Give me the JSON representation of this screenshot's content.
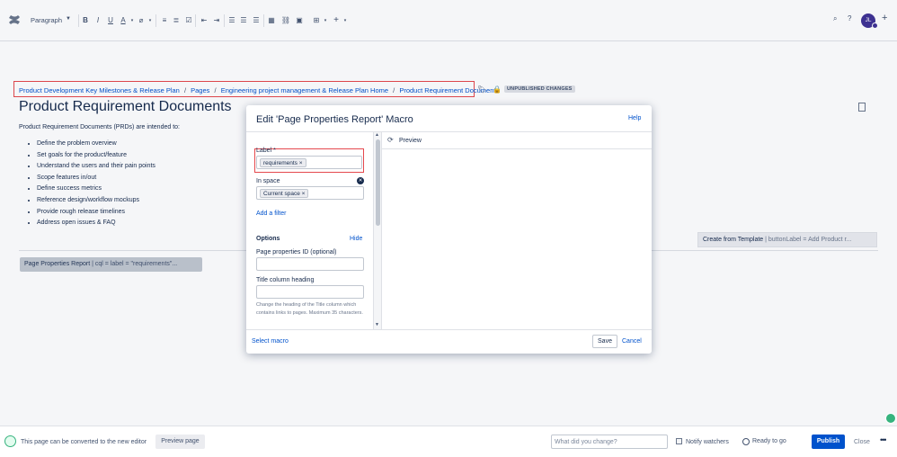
{
  "toolbar": {
    "paragraph_label": "Paragraph",
    "icons": [
      "bold-icon",
      "italic-icon",
      "underline-icon",
      "text-color-icon",
      "clear-format-icon",
      "bullet-list-icon",
      "numbered-list-icon",
      "task-list-icon",
      "outdent-icon",
      "indent-icon",
      "align-left-icon",
      "align-center-icon",
      "align-right-icon",
      "layout-icon",
      "link-icon",
      "image-icon",
      "table-icon",
      "insert-more-icon"
    ],
    "avatar_initials": "JL"
  },
  "breadcrumb": {
    "items": [
      "Product Development Key Milestones & Release Plan",
      "Pages",
      "Engineering project management & Release Plan Home",
      "Product Requirement Documents"
    ],
    "separator": "/"
  },
  "status_badge": "UNPUBLISHED CHANGES",
  "page": {
    "title": "Product Requirement Documents",
    "intro": "Product Requirement Documents (PRDs) are intended to:",
    "bullets": [
      "Define the problem overview",
      "Set goals for the product/feature",
      "Understand the users and their pain points",
      "Scope features in/out",
      "Define success metrics",
      "Reference design/workflow mockups",
      "Provide rough release timelines",
      "Address open issues & FAQ"
    ],
    "report_macro_title": "Page Properties Report",
    "report_macro_params": " | cql = label = \"requirements\"...",
    "template_macro_title": "Create from Template",
    "template_macro_params": " | buttonLabel = Add Product r..."
  },
  "dialog": {
    "title": "Edit 'Page Properties Report' Macro",
    "help": "Help",
    "label_field": "Label *",
    "label_chip": "requirements",
    "in_space_field": "In space",
    "in_space_chip": "Current space",
    "add_filter": "Add a filter",
    "options": "Options",
    "hide": "Hide",
    "page_properties_id": "Page properties ID (optional)",
    "title_column_heading": "Title column heading",
    "title_hint": "Change the heading of the Title column which contains links to pages. Maximum 35 characters.",
    "preview": "Preview",
    "select_macro": "Select macro",
    "save": "Save",
    "cancel": "Cancel",
    "chip_remove": "×"
  },
  "footer": {
    "convert_text": "This page can be converted to the new editor",
    "preview_page": "Preview page",
    "change_placeholder": "What did you change?",
    "notify_watchers": "Notify watchers",
    "ready_to_go": "Ready to go",
    "publish": "Publish",
    "close": "Close"
  },
  "colors": {
    "accent": "#0052cc",
    "highlight": "#e5484d",
    "avatar": "#403294",
    "success": "#36b37e"
  }
}
